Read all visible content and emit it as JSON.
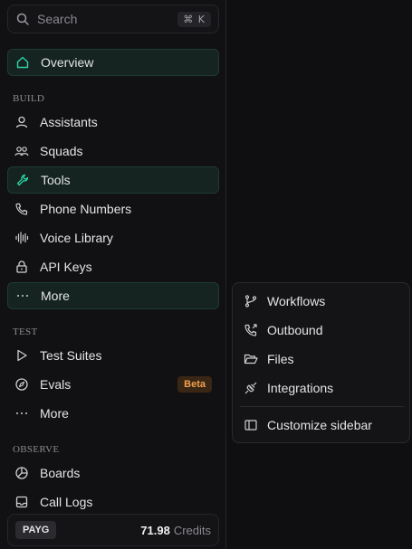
{
  "search": {
    "placeholder": "Search",
    "shortcut": "⌘ K"
  },
  "nav": {
    "overview": "Overview",
    "build_header": "BUILD",
    "build_items": [
      "Assistants",
      "Squads",
      "Tools",
      "Phone Numbers",
      "Voice Library",
      "API Keys",
      "More"
    ],
    "test_header": "TEST",
    "test_items": [
      "Test Suites",
      "Evals",
      "More"
    ],
    "evals_badge": "Beta",
    "observe_header": "OBSERVE",
    "observe_items": [
      "Boards",
      "Call Logs"
    ]
  },
  "footer": {
    "plan": "PAYG",
    "credits_value": "71.98",
    "credits_label": "Credits"
  },
  "more_menu": {
    "items": [
      "Workflows",
      "Outbound",
      "Files",
      "Integrations"
    ],
    "customize": "Customize sidebar"
  },
  "colors": {
    "accent": "#2dd4a7",
    "active_bg": "#152420",
    "beta": "#f0a050"
  },
  "icons": {
    "overview": "home-icon",
    "assistants": "user-icon",
    "squads": "users-icon",
    "tools": "wrench-icon",
    "phone": "phone-icon",
    "voice": "waveform-icon",
    "api": "lock-icon",
    "more": "ellipsis-icon"
  }
}
